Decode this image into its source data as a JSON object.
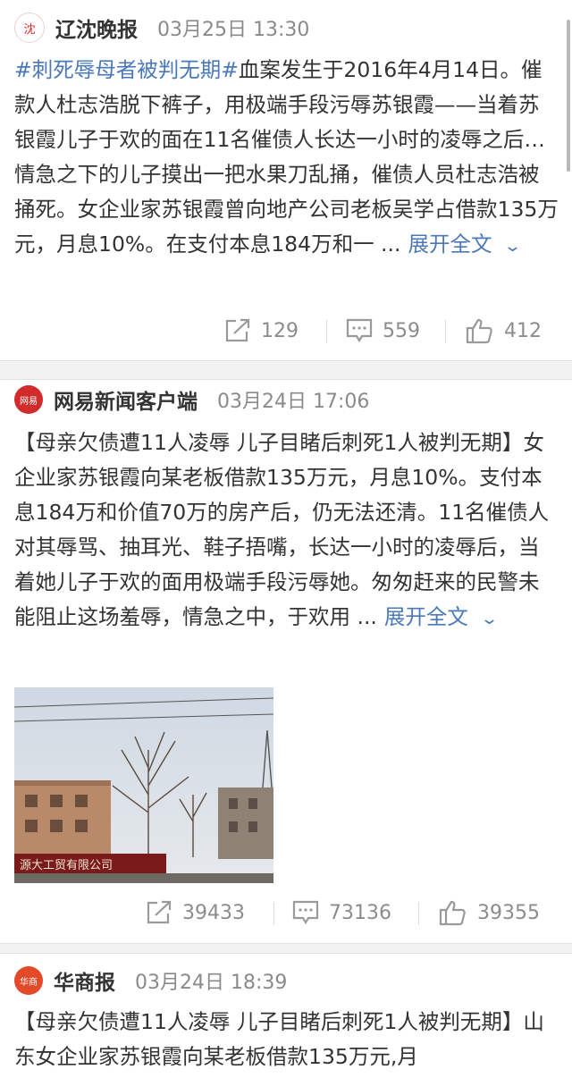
{
  "posts": [
    {
      "source": "辽沈晚报",
      "time": "03月25日 13:30",
      "avatar_label": "沈",
      "hashtag": "#刺死辱母者被判无期#",
      "text": "血案发生于2016年4月14日。催款人杜志浩脱下裤子，用极端手段污辱苏银霞——当着苏银霞儿子于欢的面在11名催债人长达一小时的凌辱之后…情急之下的儿子摸出一把水果刀乱捅，催债人员杜志浩被捅死。女企业家苏银霞曾向地产公司老板吴学占借款135万元，月息10%。在支付本息184万和一 ...",
      "expand_label": "展开全文",
      "reposts": "129",
      "comments": "559",
      "likes": "412"
    },
    {
      "source": "网易新闻客户端",
      "time": "03月24日 17:06",
      "avatar_label": "网易",
      "text": "【母亲欠债遭11人凌辱 儿子目睹后刺死1人被判无期】女企业家苏银霞向某老板借款135万元，月息10%。支付本息184万和价值70万的房产后，仍无法还清。11名催债人对其辱骂、抽耳光、鞋子捂嘴，长达一小时的凌辱后，当着她儿子于欢的面用极端手段污辱她。匆匆赶来的民警未能阻止这场羞辱，情急之中，于欢用 ...",
      "expand_label": "展开全文",
      "photo_sign": "源大工贸有限公司",
      "reposts": "39433",
      "comments": "73136",
      "likes": "39355"
    },
    {
      "source": "华商报",
      "time": "03月24日 18:39",
      "avatar_label": "华商",
      "text": "【母亲欠债遭11人凌辱 儿子目睹后刺死1人被判无期】山东女企业家苏银霞向某老板借款135万元,月"
    }
  ],
  "icons": {
    "repost": "repost-icon",
    "comment": "comment-icon",
    "like": "like-icon",
    "expand": "chevron-down-icon"
  },
  "colors": {
    "link": "#4a78b8",
    "text": "#333333",
    "meta": "#8a8a8a"
  }
}
